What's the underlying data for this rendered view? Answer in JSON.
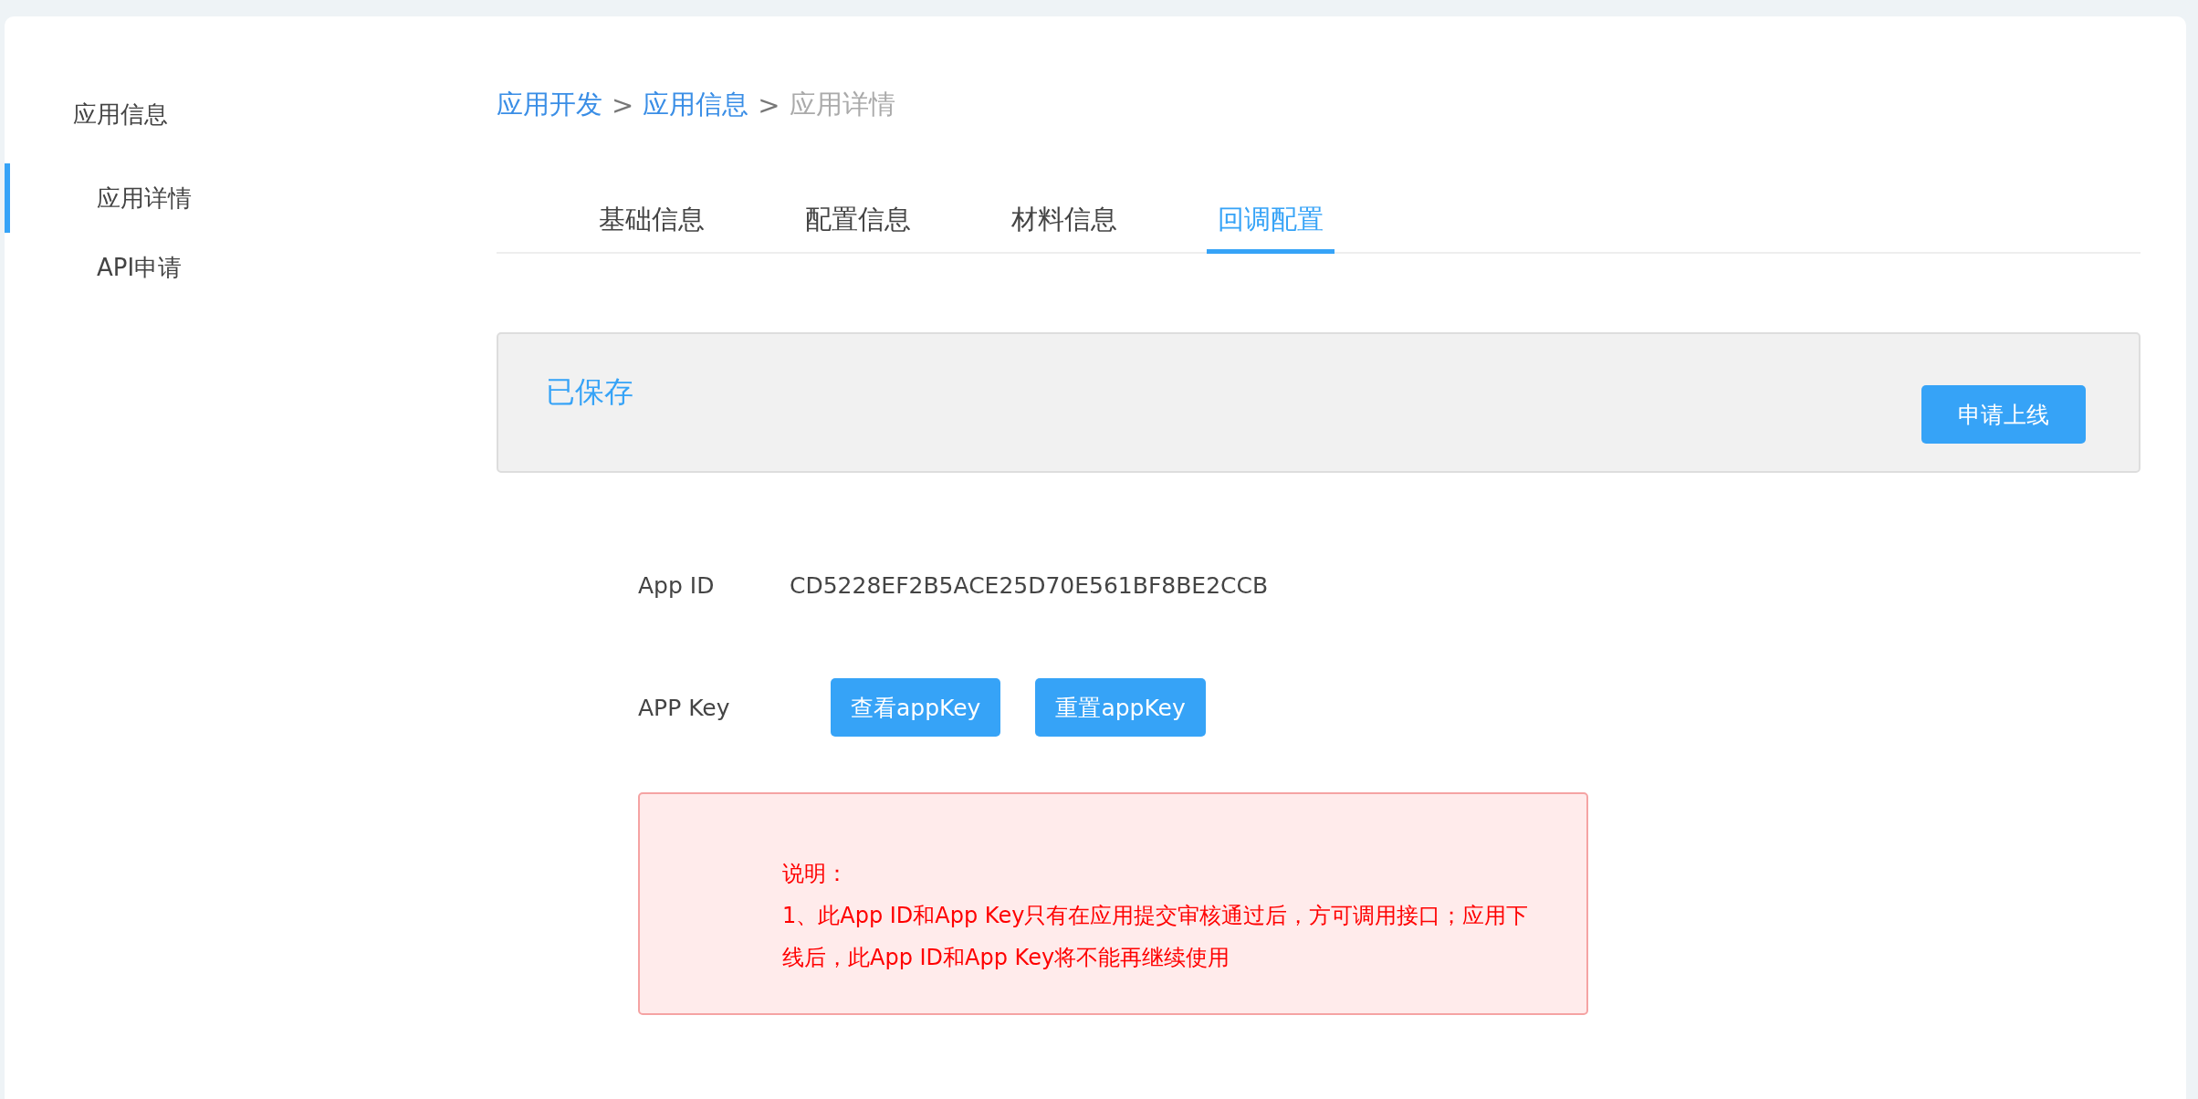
{
  "sidebar": {
    "title": "应用信息",
    "items": [
      {
        "label": "应用详情",
        "selected": true
      },
      {
        "label": "API申请",
        "selected": false
      }
    ]
  },
  "breadcrumb": [
    {
      "label": "应用开发",
      "kind": "link"
    },
    {
      "label": ">",
      "kind": "separator"
    },
    {
      "label": "应用信息",
      "kind": "link"
    },
    {
      "label": ">",
      "kind": "separator"
    },
    {
      "label": "应用详情",
      "kind": "current"
    }
  ],
  "tabs": [
    {
      "label": "基础信息",
      "selected": false
    },
    {
      "label": "配置信息",
      "selected": false
    },
    {
      "label": "材料信息",
      "selected": false
    },
    {
      "label": "回调配置",
      "selected": true
    }
  ],
  "status_panel": {
    "status": "已保存",
    "button": "申请上线"
  },
  "fields": [
    {
      "label": "App ID",
      "kind": "text",
      "value": "CD5228EF2B5ACE25D70E561BF8BE2CCB"
    },
    {
      "label": "APP Key",
      "kind": "buttons",
      "buttons": [
        "查看appKey",
        "重置appKey"
      ]
    }
  ],
  "notice": {
    "title": "说明：",
    "text": "1、此App ID和App Key只有在应用提交审核通过后，方可调用接口；应用下线后，此App ID和App Key将不能再继续使用"
  }
}
